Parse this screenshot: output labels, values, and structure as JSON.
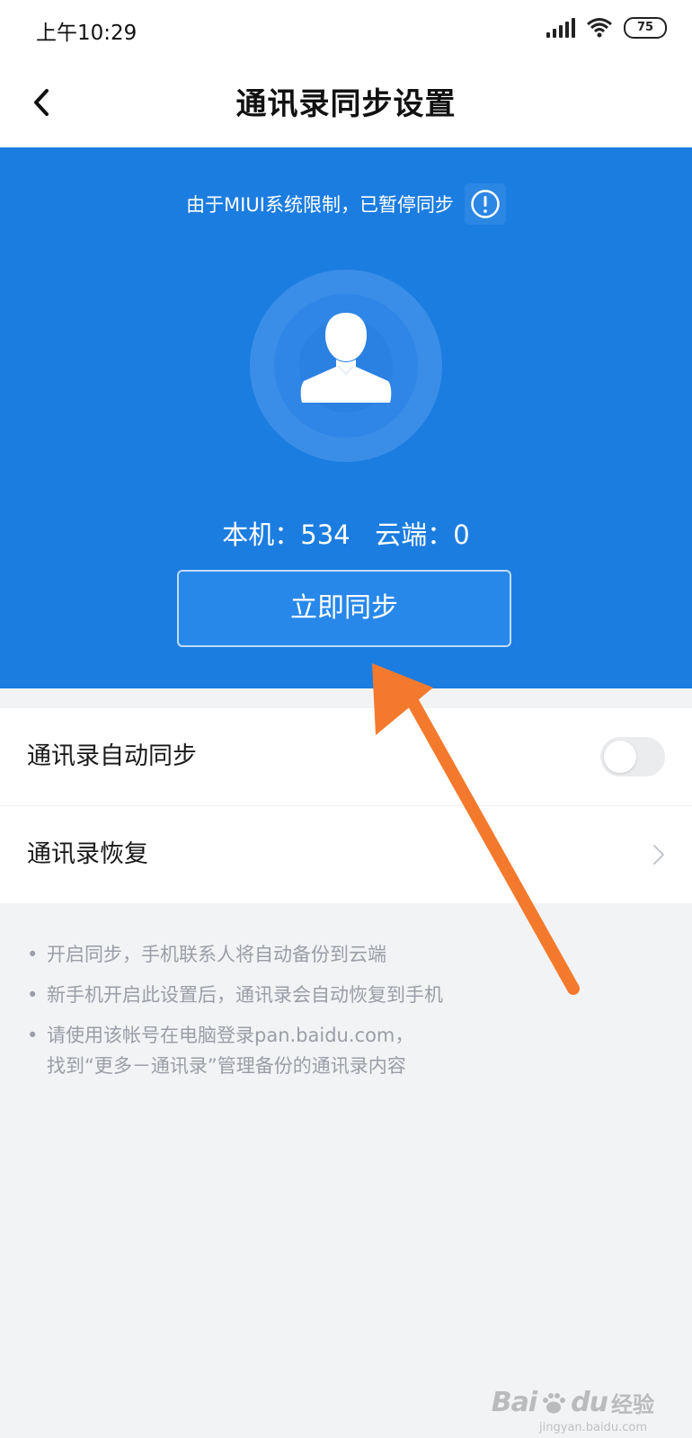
{
  "status_bar": {
    "time": "上午10:29",
    "battery": "75",
    "icons": [
      "signal-icon",
      "wifi-icon",
      "battery-icon"
    ]
  },
  "nav": {
    "title": "通讯录同步设置",
    "back_icon": "chevron-left-icon"
  },
  "hero": {
    "notice": "由于MIUI系统限制，已暂停同步",
    "info_icon": "info-circle-icon",
    "avatar_icon": "person-icon",
    "local_label": "本机：",
    "local_count": "534",
    "cloud_label": "云端：",
    "cloud_count": "0",
    "sync_button": "立即同步",
    "background_color": "#1c7de0"
  },
  "settings": [
    {
      "label": "通讯录自动同步",
      "control": "toggle",
      "checked": false
    },
    {
      "label": "通讯录恢复",
      "control": "chevron"
    }
  ],
  "tips": [
    {
      "lines": [
        "开启同步，手机联系人将自动备份到云端"
      ]
    },
    {
      "lines": [
        "新手机开启此设置后，通讯录会自动恢复到手机"
      ]
    },
    {
      "lines": [
        "请使用该帐号在电脑登录pan.baidu.com，",
        "找到“更多－通讯录”管理备份的通讯录内容"
      ]
    }
  ],
  "tip_bullet": "•",
  "watermark": {
    "brand": "Bai",
    "brand2": "du",
    "cn": "经验",
    "url": "jingyan.baidu.com"
  },
  "annotation_color": "#f37a2d"
}
